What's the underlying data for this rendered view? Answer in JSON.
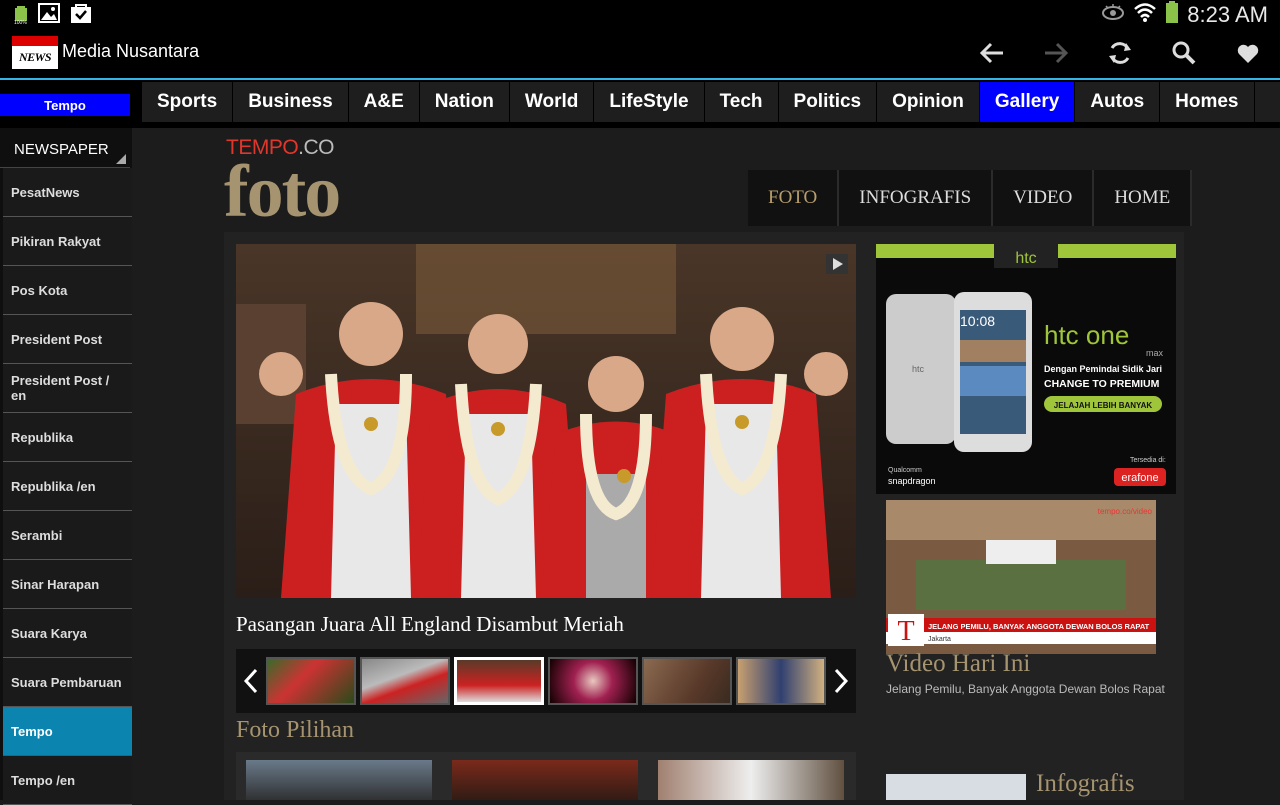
{
  "status_bar": {
    "battery_text": "100%",
    "time": "8:23 AM"
  },
  "app_bar": {
    "logo_text": "NEWS",
    "title": "Media Nusantara"
  },
  "source_badge": "Tempo",
  "categories": [
    {
      "label": "Sports",
      "active": false
    },
    {
      "label": "Business",
      "active": false
    },
    {
      "label": "A&E",
      "active": false
    },
    {
      "label": "Nation",
      "active": false
    },
    {
      "label": "World",
      "active": false
    },
    {
      "label": "LifeStyle",
      "active": false
    },
    {
      "label": "Tech",
      "active": false
    },
    {
      "label": "Politics",
      "active": false
    },
    {
      "label": "Opinion",
      "active": false
    },
    {
      "label": "Gallery",
      "active": true
    },
    {
      "label": "Autos",
      "active": false
    },
    {
      "label": "Homes",
      "active": false
    }
  ],
  "sidebar": {
    "header": "NEWSPAPER",
    "items": [
      {
        "label": "PesatNews"
      },
      {
        "label": "Pikiran Rakyat"
      },
      {
        "label": "Pos Kota"
      },
      {
        "label": "President Post"
      },
      {
        "label": "President Post / en"
      },
      {
        "label": "Republika"
      },
      {
        "label": "Republika /en"
      },
      {
        "label": "Serambi"
      },
      {
        "label": "Sinar Harapan"
      },
      {
        "label": "Suara Karya"
      },
      {
        "label": "Suara Pembaruan"
      },
      {
        "label": "Tempo"
      },
      {
        "label": "Tempo /en"
      }
    ],
    "active_index": 11
  },
  "web": {
    "logo_main": "TEMPO",
    "logo_suffix": ".CO",
    "section_title": "foto",
    "tabs": [
      "FOTO",
      "INFOGRAFIS",
      "VIDEO",
      "HOME"
    ],
    "main_caption": "Pasangan Juara All England Disambut Meriah",
    "foto_pilihan": "Foto Pilihan",
    "ad": {
      "brand": "htc",
      "product": "htc one",
      "product_sub": "max",
      "tagline": "Dengan Pemindai Sidik Jari",
      "headline": "CHANGE TO PREMIUM",
      "cta": "JELAJAH LEBIH BANYAK",
      "phone_time": "10:08",
      "phone_brand": "htc",
      "chip_brand": "Qualcomm",
      "chip_name": "snapdragon",
      "available_at": "Tersedia di:",
      "store": "erafone"
    },
    "video": {
      "overlay_corner": "tempo.co/video",
      "overlay_headline": "JELANG PEMILU, BANYAK ANGGOTA DEWAN BOLOS RAPAT",
      "overlay_city": "Jakarta",
      "overlay_logo": "T",
      "title": "Video Hari Ini",
      "description": "Jelang Pemilu, Banyak Anggota Dewan Bolos Rapat"
    },
    "infografis_title": "Infografis"
  },
  "colors": {
    "accent_blue": "#0000ff",
    "sidebar_active": "#0b85b0",
    "gold": "#a69470",
    "tempo_red": "#e0372d",
    "ad_green": "#9fc53a"
  }
}
